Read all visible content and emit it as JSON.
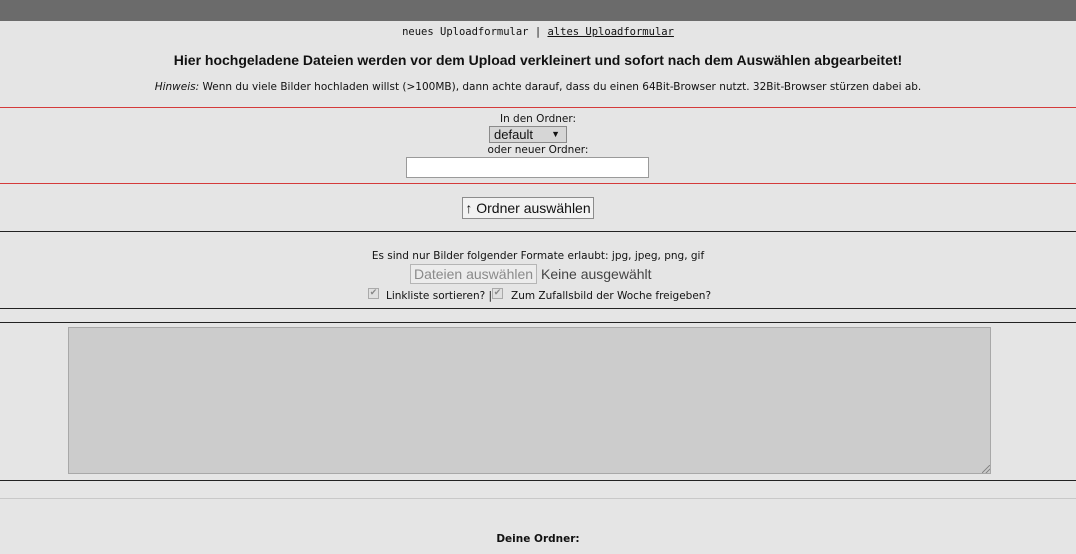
{
  "nav": {
    "current": "neues Uploadformular",
    "separator": "|",
    "old_link": "altes Uploadformular"
  },
  "heading": "Hier hochgeladene Dateien werden vor dem Upload verkleinert und sofort nach dem Auswählen abgearbeitet!",
  "hint": {
    "label": "Hinweis:",
    "text": " Wenn du viele Bilder hochladen willst (>100MB), dann achte darauf, dass du einen 64Bit-Browser nutzt. 32Bit-Browser stürzen dabei ab."
  },
  "folder": {
    "label": "In den Ordner:",
    "selected": "default",
    "new_label": "oder neuer Ordner:",
    "new_value": ""
  },
  "folder_button": "↑ Ordner auswählen",
  "formats": "Es sind nur Bilder folgender Formate erlaubt: jpg, jpeg, png, gif",
  "file_button": "Dateien auswählen",
  "file_status": "Keine ausgewählt",
  "options": {
    "sort_label": "Linkliste sortieren? |",
    "sort_checked": true,
    "random_label": "Zum Zufallsbild der Woche freigeben?",
    "random_checked": true,
    "check_glyph": "✔"
  },
  "output_text": "",
  "your_folders": "Deine Ordner:"
}
